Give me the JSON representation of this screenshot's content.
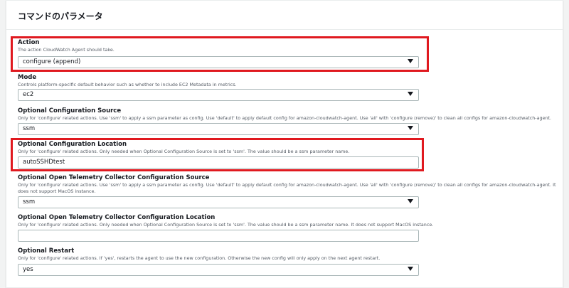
{
  "panel": {
    "title": "コマンドのパラメータ"
  },
  "fields": {
    "action": {
      "label": "Action",
      "description": "The action CloudWatch Agent should take.",
      "value": "configure (append)"
    },
    "mode": {
      "label": "Mode",
      "description": "Controls platform-specific default behavior such as whether to include EC2 Metadata in metrics.",
      "value": "ec2"
    },
    "config_source": {
      "label": "Optional Configuration Source",
      "description": "Only for 'configure' related actions. Use 'ssm' to apply a ssm parameter as config. Use 'default' to apply default config for amazon-cloudwatch-agent. Use 'all' with 'configure (remove)' to clean all configs for amazon-cloudwatch-agent.",
      "value": "ssm"
    },
    "config_location": {
      "label": "Optional Configuration Location",
      "description": "Only for 'configure' related actions. Only needed when Optional Configuration Source is set to 'ssm'. The value should be a ssm parameter name.",
      "value": "autoSSHDtest"
    },
    "otel_source": {
      "label": "Optional Open Telemetry Collector Configuration Source",
      "description": "Only for 'configure' related actions. Use 'ssm' to apply a ssm parameter as config. Use 'default' to apply default config for amazon-cloudwatch-agent. Use 'all' with 'configure (remove)' to clean all configs for amazon-cloudwatch-agent. It does not support MacOS instance.",
      "value": "ssm"
    },
    "otel_location": {
      "label": "Optional Open Telemetry Collector Configuration Location",
      "description": "Only for 'configure' related actions. Only needed when Optional Configuration Source is set to 'ssm'. The value should be a ssm parameter name. It does not support MacOS instance.",
      "value": ""
    },
    "restart": {
      "label": "Optional Restart",
      "description": "Only for 'configure' related actions. If 'yes', restarts the agent to use the new configuration. Otherwise the new config will only apply on the next agent restart.",
      "value": "yes"
    }
  },
  "colors": {
    "highlight": "#e0191f",
    "border": "#aab7b8",
    "background": "#f2f3f3"
  }
}
